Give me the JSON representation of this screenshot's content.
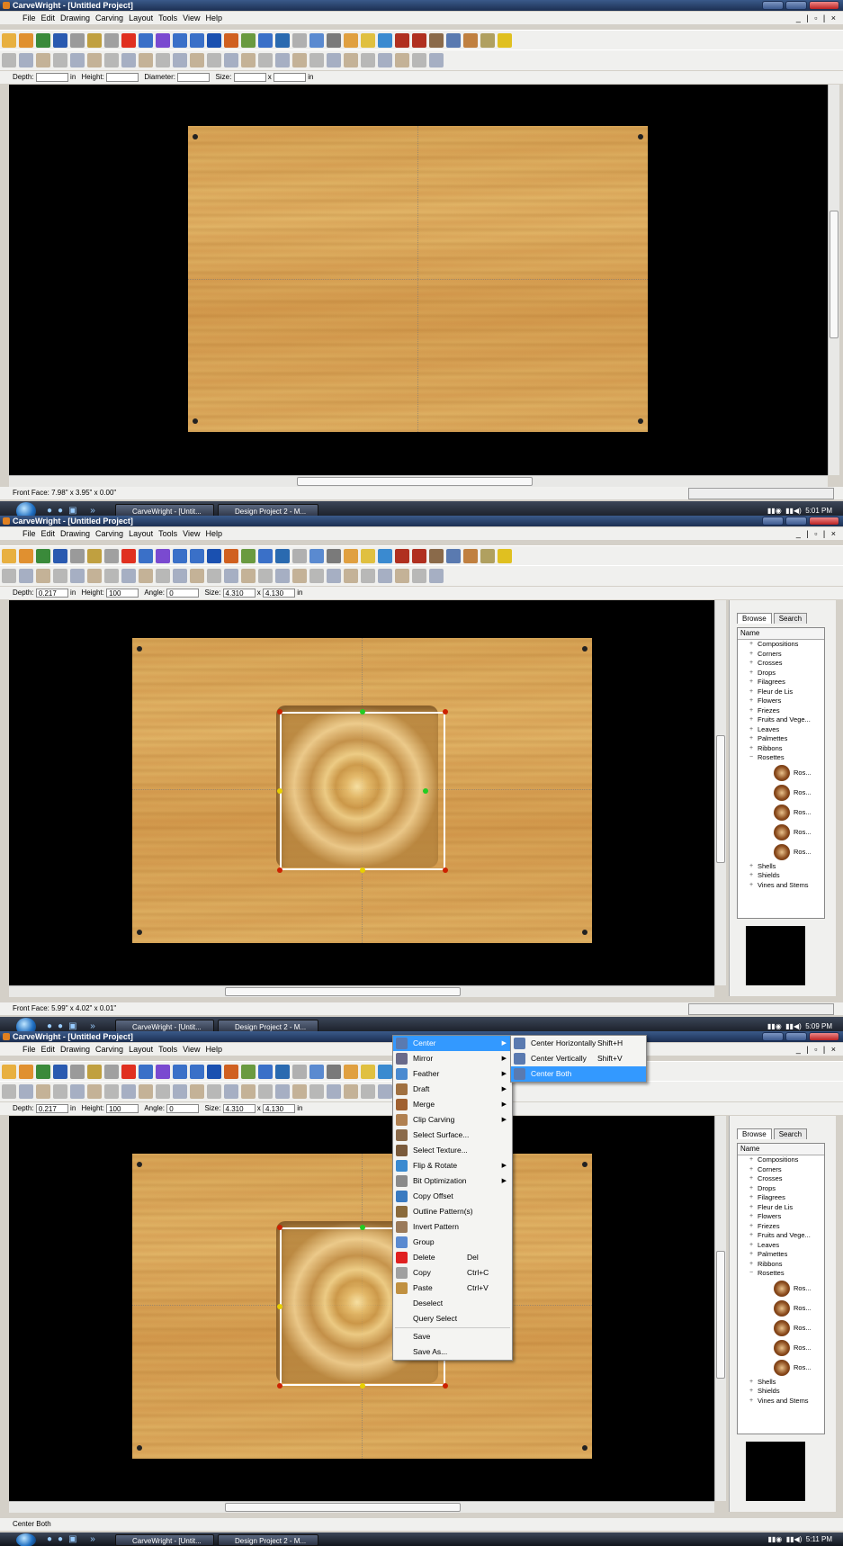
{
  "app": {
    "title": "CarveWright - [Untitled Project]",
    "menus": [
      "File",
      "Edit",
      "Drawing",
      "Carving",
      "Layout",
      "Tools",
      "View",
      "Help"
    ],
    "mdi_controls": "_ | ▫ | ×"
  },
  "dims_empty": {
    "depth_label": "Depth:",
    "unit_in": "in",
    "height_label": "Height:",
    "diameter_label": "Diameter:",
    "size_label": "Size:",
    "size_x": "x",
    "size_unit": "in"
  },
  "dims": {
    "depth_label": "Depth:",
    "depth": "0.217",
    "unit_in": "in",
    "height_label": "Height:",
    "height": "100",
    "angle_label": "Angle:",
    "angle": "0",
    "size_label": "Size:",
    "size_w": "4.310",
    "size_x": "x",
    "size_h": "4.130",
    "size_unit": "in"
  },
  "panel1": {
    "status": "Front Face: 7.98\" x 3.95\" x 0.00\"",
    "clock": "5:01 PM"
  },
  "panel2": {
    "status": "Front Face: 5.99\" x 4.02\" x 0.01\"",
    "clock": "5:09 PM"
  },
  "panel3": {
    "status": "Center Both",
    "clock": "5:11 PM"
  },
  "taskbar": {
    "task1": "CarveWright - [Untit...",
    "task2": "Design Project 2 - M..."
  },
  "library": {
    "tab_browse": "Browse",
    "tab_search": "Search",
    "column": "Name",
    "categories": [
      "Compositions",
      "Corners",
      "Crosses",
      "Drops",
      "Filagrees",
      "Fleur de Lis",
      "Flowers",
      "Friezes",
      "Fruits and Vege...",
      "Leaves",
      "Palmettes",
      "Ribbons",
      "Rosettes"
    ],
    "rosette_items": [
      "Ros...",
      "Ros...",
      "Ros...",
      "Ros...",
      "Ros..."
    ],
    "after": [
      "Shells",
      "Shields",
      "Vines and Stems"
    ]
  },
  "context_menu": {
    "items": [
      {
        "label": "Center",
        "icon": "center-icon",
        "submenu": true,
        "highlight": true
      },
      {
        "label": "Mirror",
        "icon": "mirror-icon",
        "submenu": true
      },
      {
        "label": "Feather",
        "icon": "feather-icon",
        "submenu": true
      },
      {
        "label": "Draft",
        "icon": "draft-icon",
        "submenu": true
      },
      {
        "label": "Merge",
        "icon": "merge-icon",
        "submenu": true
      },
      {
        "label": "Clip Carving",
        "icon": "clip-icon",
        "submenu": true
      },
      {
        "label": "Select Surface...",
        "icon": "surface-icon"
      },
      {
        "label": "Select Texture...",
        "icon": "texture-icon"
      },
      {
        "label": "Flip & Rotate",
        "icon": "flip-icon",
        "submenu": true
      },
      {
        "label": "Bit Optimization",
        "icon": "bit-icon",
        "submenu": true
      },
      {
        "label": "Copy Offset",
        "icon": "copy-offset-icon"
      },
      {
        "label": "Outline Pattern(s)",
        "icon": "outline-icon"
      },
      {
        "label": "Invert Pattern",
        "icon": "invert-icon"
      },
      {
        "label": "Group",
        "icon": "group-icon"
      },
      {
        "label": "Delete",
        "icon": "delete-icon",
        "shortcut": "Del"
      },
      {
        "label": "Copy",
        "icon": "copy-icon",
        "shortcut": "Ctrl+C"
      },
      {
        "label": "Paste",
        "icon": "paste-icon",
        "shortcut": "Ctrl+V"
      },
      {
        "label": "Deselect"
      },
      {
        "label": "Query Select"
      },
      {
        "label": "Save"
      },
      {
        "label": "Save As..."
      }
    ],
    "submenu": [
      {
        "label": "Center Horizontally",
        "shortcut": "Shift+H",
        "icon": "center-h-icon"
      },
      {
        "label": "Center Vertically",
        "shortcut": "Shift+V",
        "icon": "center-v-icon"
      },
      {
        "label": "Center Both",
        "icon": "center-both-icon",
        "highlight": true
      }
    ]
  },
  "colors": {
    "menu_highlight": "#3399ff",
    "selection": "#ffffff",
    "handle_red": "#cc2200",
    "handle_yellow": "#e8d000",
    "handle_green": "#22cc22",
    "board": "#dcab5e"
  }
}
